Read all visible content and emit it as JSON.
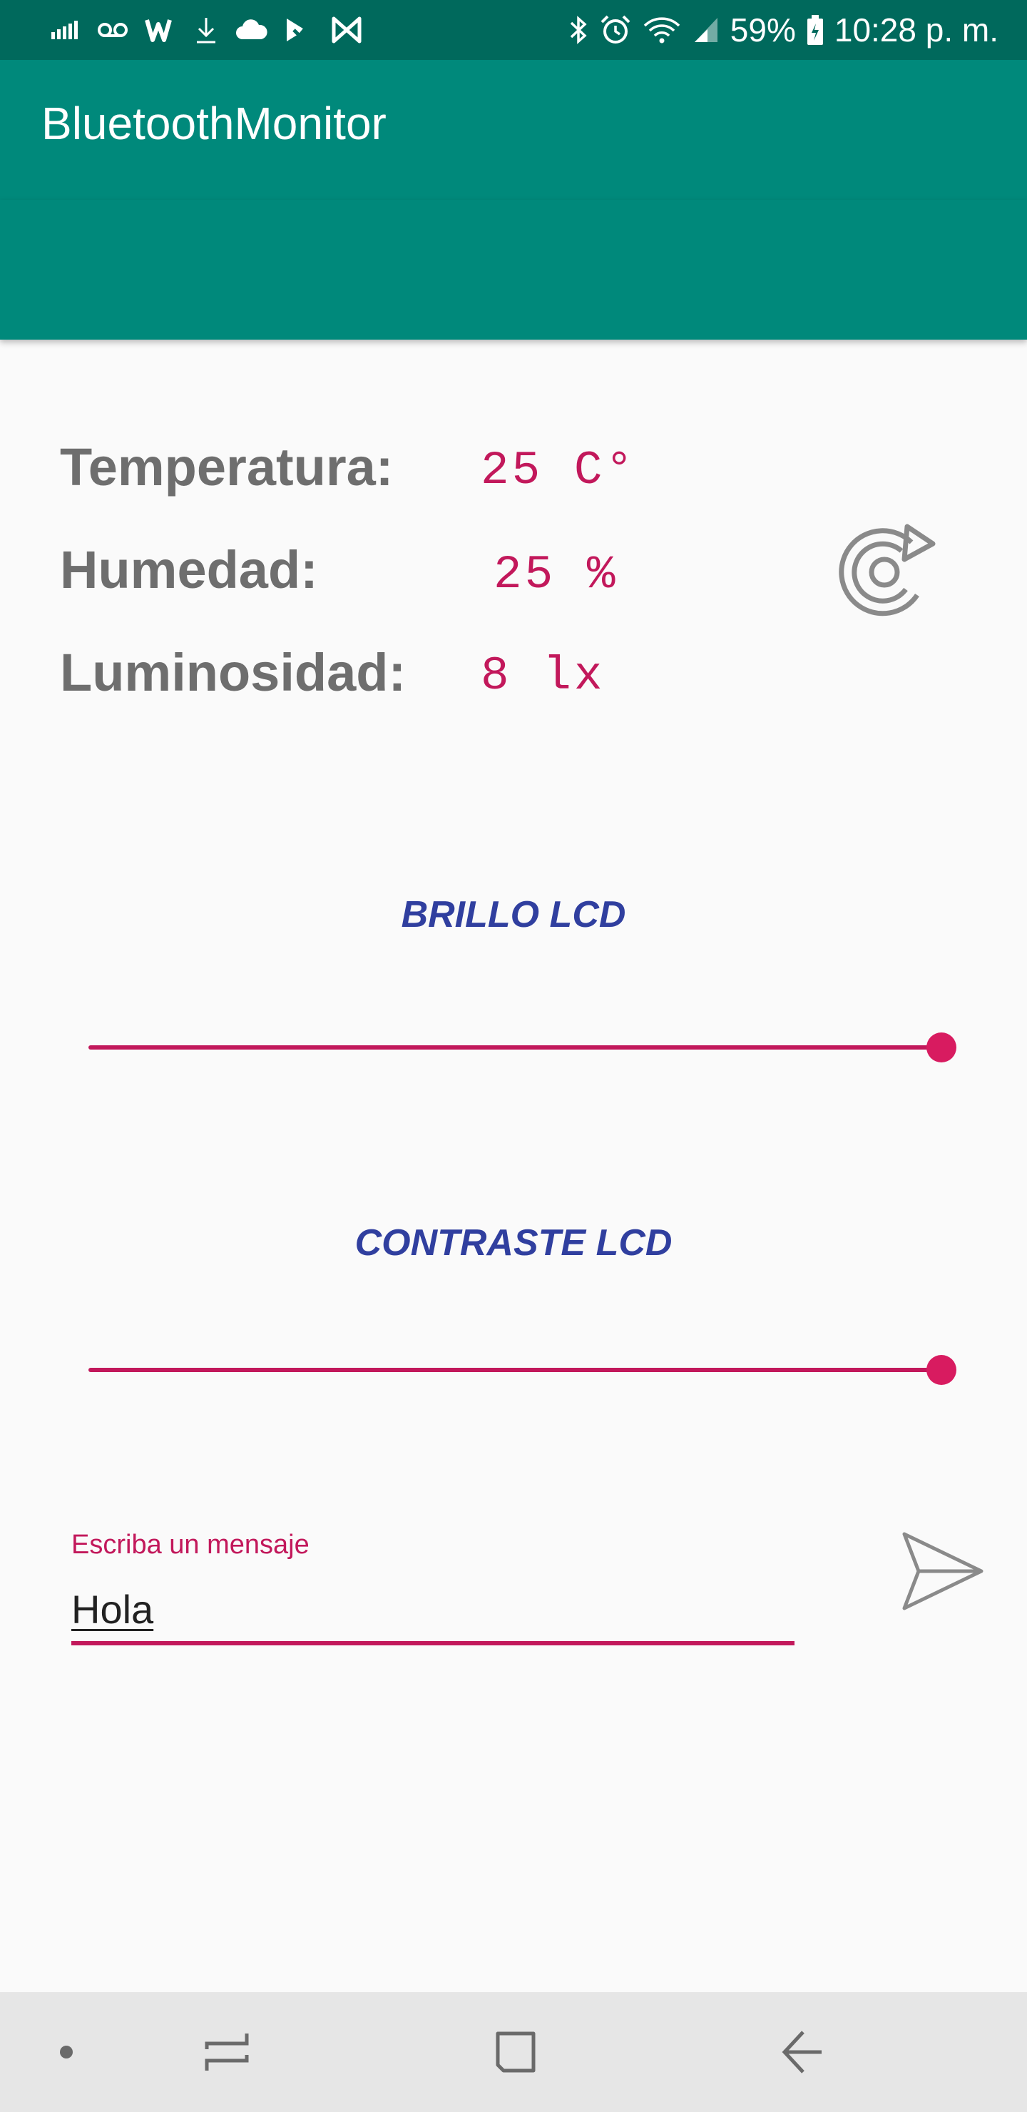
{
  "status_bar": {
    "battery": "59%",
    "time": "10:28 p. m."
  },
  "app_bar": {
    "title": "BluetoothMonitor"
  },
  "readings": [
    {
      "label": "Temperatura:",
      "value": "25 C°"
    },
    {
      "label": "Humedad:",
      "value": "25 %"
    },
    {
      "label": "Luminosidad:",
      "value": "8 lx"
    }
  ],
  "brightness": {
    "title": "BRILLO LCD",
    "level": 1.0
  },
  "contrast": {
    "title": "CONTRASTE LCD",
    "level": 1.0
  },
  "message": {
    "label": "Escriba un mensaje",
    "value": "Hola"
  },
  "colors": {
    "status_bar": "#00695c",
    "app_bar": "#00897b",
    "accent": "#c2185b",
    "section_title": "#303f9f",
    "label_text": "#6e6e6e"
  },
  "icons": {
    "status_left": [
      "signal-bars-icon",
      "voicemail-icon",
      "w-app-icon",
      "download-icon",
      "cloud-icon",
      "app-check-icon",
      "app-bowtie-icon"
    ],
    "status_right": [
      "bluetooth-icon",
      "alarm-icon",
      "wifi-icon",
      "cell-signal-icon",
      "battery-icon"
    ],
    "refresh": "refresh-icon",
    "send": "send-icon",
    "nav": [
      "nav-dot-icon",
      "recents-icon",
      "home-icon",
      "back-icon"
    ]
  }
}
